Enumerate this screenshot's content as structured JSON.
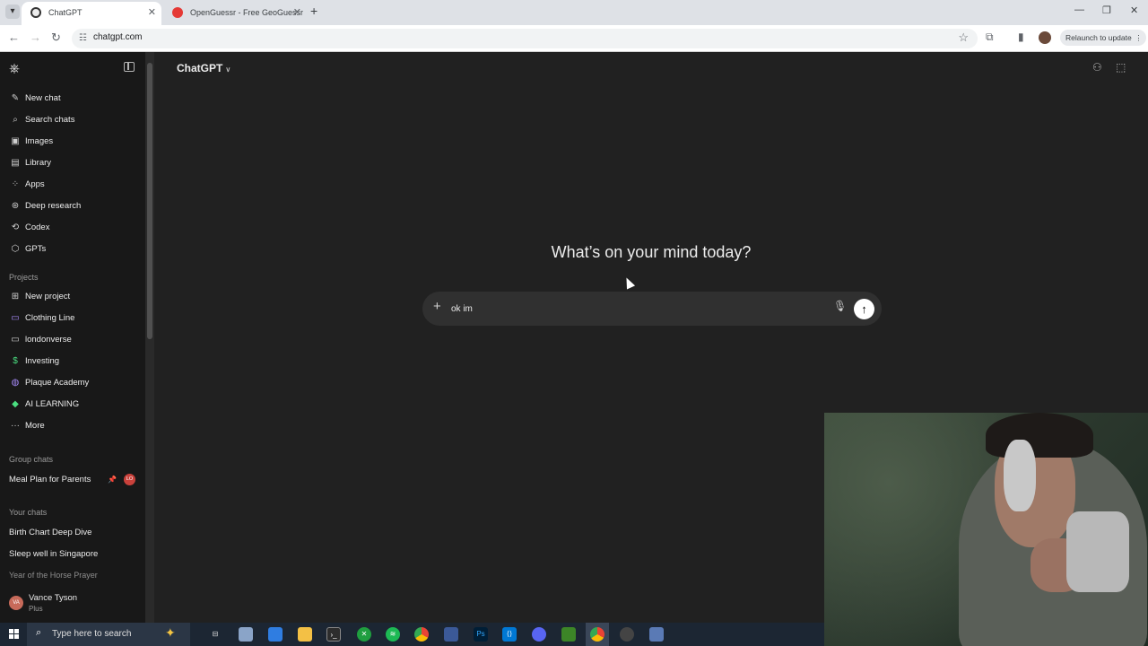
{
  "browser": {
    "tabs": [
      {
        "label": "ChatGPT",
        "active": true
      },
      {
        "label": "OpenGuessr - Free GeoGuessr",
        "active": false
      }
    ],
    "url": "chatgpt.com",
    "relaunch_label": "Relaunch to update"
  },
  "sidebar": {
    "nav": [
      {
        "label": "New chat",
        "icon": "edit-icon"
      },
      {
        "label": "Search chats",
        "icon": "search-icon"
      },
      {
        "label": "Images",
        "icon": "image-icon"
      },
      {
        "label": "Library",
        "icon": "library-icon"
      },
      {
        "label": "Apps",
        "icon": "apps-icon"
      },
      {
        "label": "Deep research",
        "icon": "telescope-icon"
      },
      {
        "label": "Codex",
        "icon": "codex-icon"
      },
      {
        "label": "GPTs",
        "icon": "gpts-icon"
      }
    ],
    "projects_heading": "Projects",
    "projects": [
      {
        "label": "New project",
        "icon": "folder-plus-icon"
      },
      {
        "label": "Clothing Line",
        "icon": "folder-icon",
        "color": "#a78bfa"
      },
      {
        "label": "londonverse",
        "icon": "folder-icon",
        "color": "#ececec"
      },
      {
        "label": "Investing",
        "icon": "dollar-icon",
        "color": "#4ade80"
      },
      {
        "label": "Plaque Academy",
        "icon": "globe-icon",
        "color": "#a78bfa"
      },
      {
        "label": "AI LEARNING",
        "icon": "graduation-icon",
        "color": "#4ade80"
      },
      {
        "label": "More",
        "icon": "more-icon"
      }
    ],
    "group_heading": "Group chats",
    "group_chats": [
      {
        "label": "Meal Plan for Parents",
        "badge": "LO"
      }
    ],
    "your_chats_heading": "Your chats",
    "chats": [
      "Birth Chart Deep Dive",
      "Sleep well in Singapore",
      "Year of the Horse Prayer"
    ],
    "user": {
      "initials": "VA",
      "name": "Vance Tyson",
      "plan": "Plus"
    }
  },
  "main": {
    "model_label": "ChatGPT",
    "headline": "What’s on your mind today?",
    "composer_value": "ok im"
  },
  "taskbar": {
    "search_placeholder": "Type here to search",
    "apps": [
      "task-view-icon",
      "app-icon",
      "app-icon",
      "file-explorer-icon",
      "terminal-icon",
      "xbox-icon",
      "spotify-icon",
      "chrome-icon",
      "app-icon",
      "photoshop-icon",
      "vscode-icon",
      "discord-icon",
      "minecraft-icon",
      "chrome-icon",
      "app-icon",
      "calculator-icon"
    ]
  }
}
